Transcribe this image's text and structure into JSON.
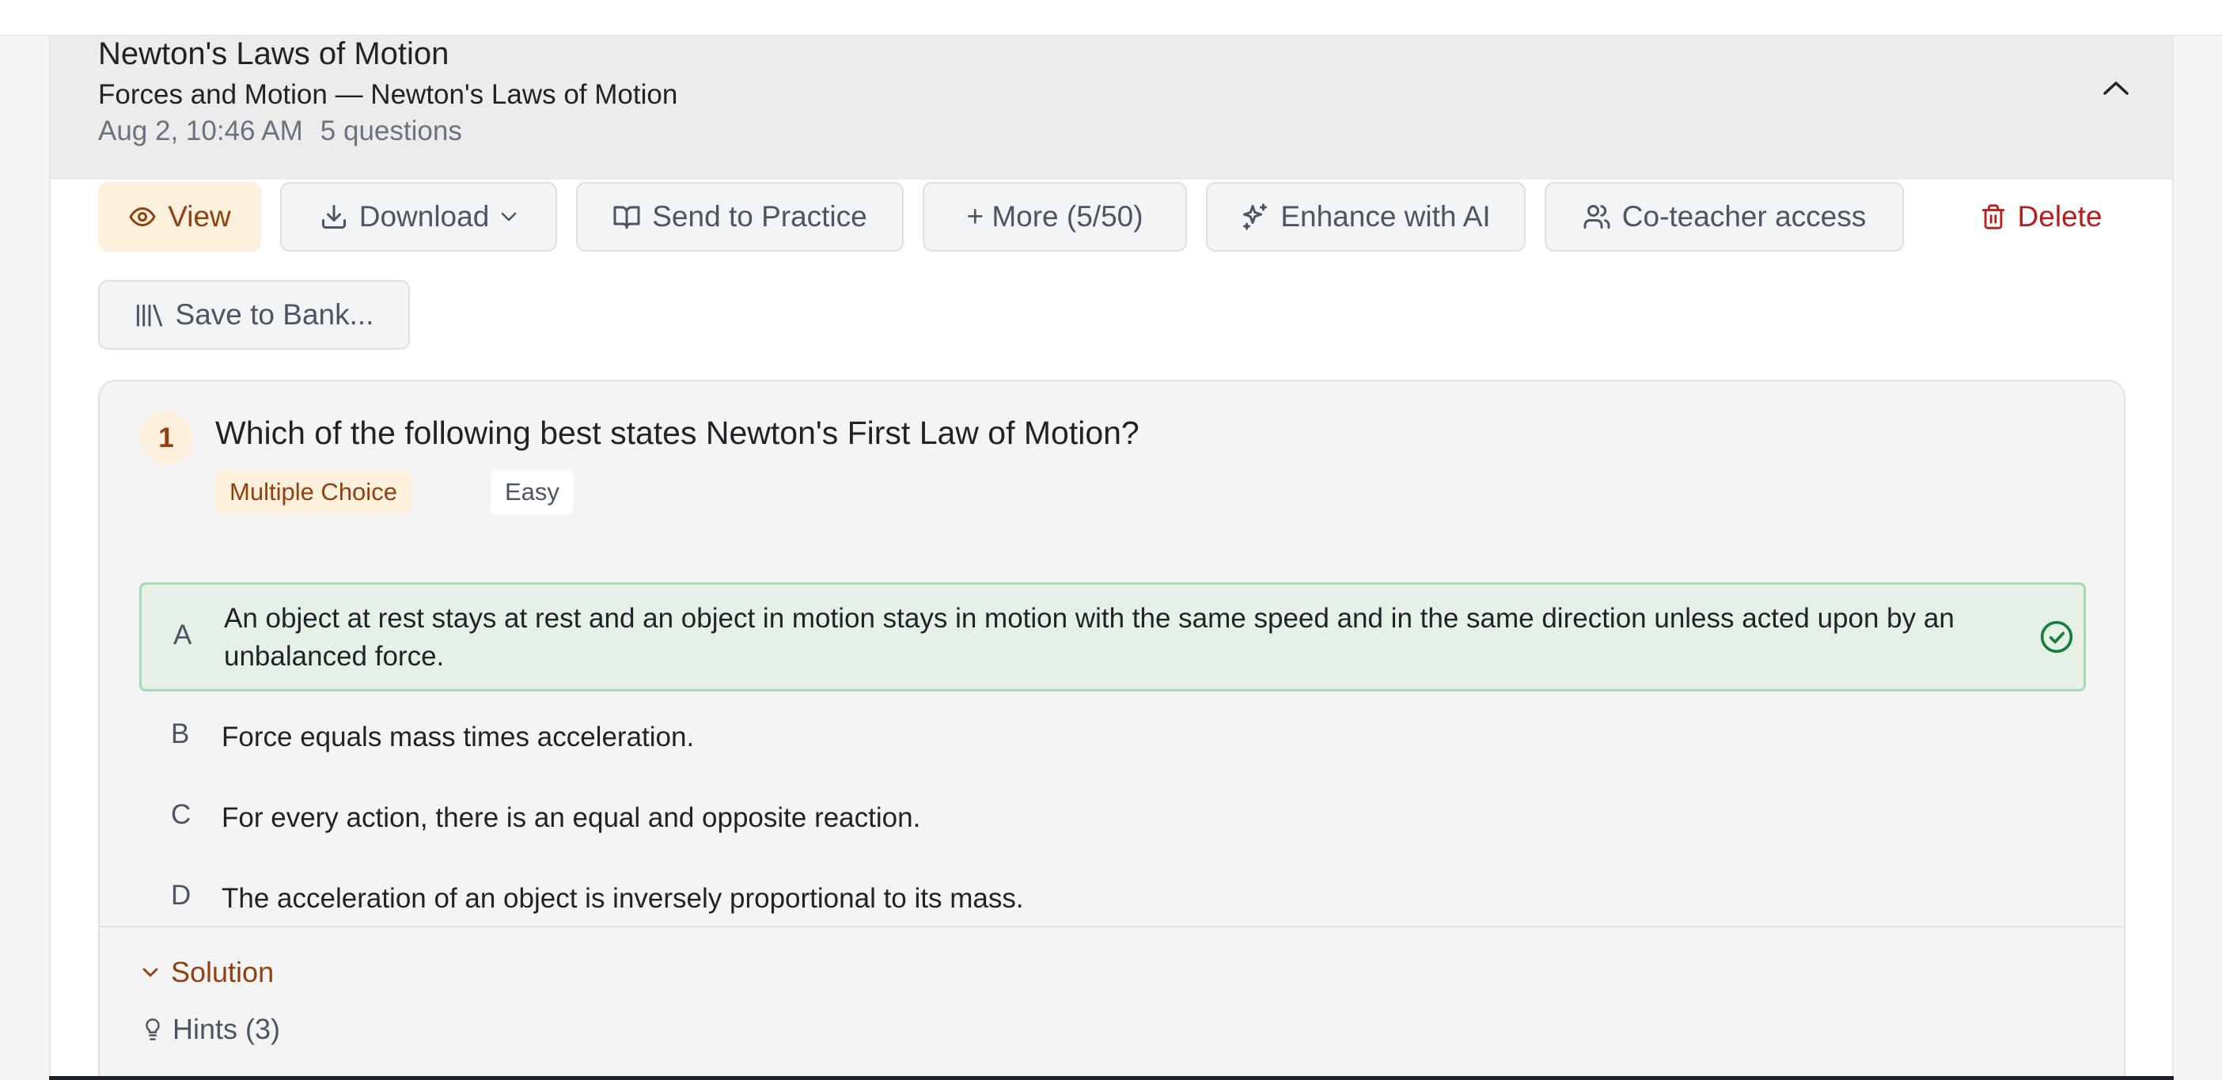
{
  "set": {
    "title": "Newton's Laws of Motion",
    "subtitle": "Forces and Motion — Newton's Laws of Motion",
    "date": "Aug 2, 10:46 AM",
    "count": "5 questions"
  },
  "actions": {
    "view": "View",
    "download": "Download",
    "send_to_practice": "Send to Practice",
    "more": "+ More (5/50)",
    "enhance": "Enhance with AI",
    "coteacher": "Co-teacher access",
    "delete": "Delete",
    "save_to_bank": "Save to Bank..."
  },
  "question": {
    "number": "1",
    "text": "Which of the following best states Newton's First Law of Motion?",
    "type": "Multiple Choice",
    "difficulty": "Easy",
    "options": [
      {
        "letter": "A",
        "text": "An object at rest stays at rest and an object in motion stays in motion with the same speed and in the same direction unless acted upon by an unbalanced force.",
        "correct": true
      },
      {
        "letter": "B",
        "text": "Force equals mass times acceleration.",
        "correct": false
      },
      {
        "letter": "C",
        "text": "For every action, there is an equal and opposite reaction.",
        "correct": false
      },
      {
        "letter": "D",
        "text": "The acceleration of an object is inversely proportional to its mass.",
        "correct": false
      }
    ],
    "solution_label": "Solution",
    "hints_label": "Hints (3)"
  },
  "icons": {
    "collapse": "chevron-up-icon",
    "view": "eye-icon",
    "download": "download-icon",
    "download_caret": "chevron-down-icon",
    "send": "book-open-icon",
    "enhance": "sparkles-icon",
    "coteacher": "users-icon",
    "delete": "trash-icon",
    "bank": "library-icon",
    "correct": "check-circle-icon",
    "solution": "chevron-down-icon",
    "hints": "lightbulb-icon"
  },
  "colors": {
    "accent": "#92400e",
    "accent_bg": "#fdf0dc",
    "correct_bg": "#e6f0e7",
    "correct_border": "#a8d9b5",
    "correct_icon": "#15803d",
    "danger": "#b91c1c"
  }
}
